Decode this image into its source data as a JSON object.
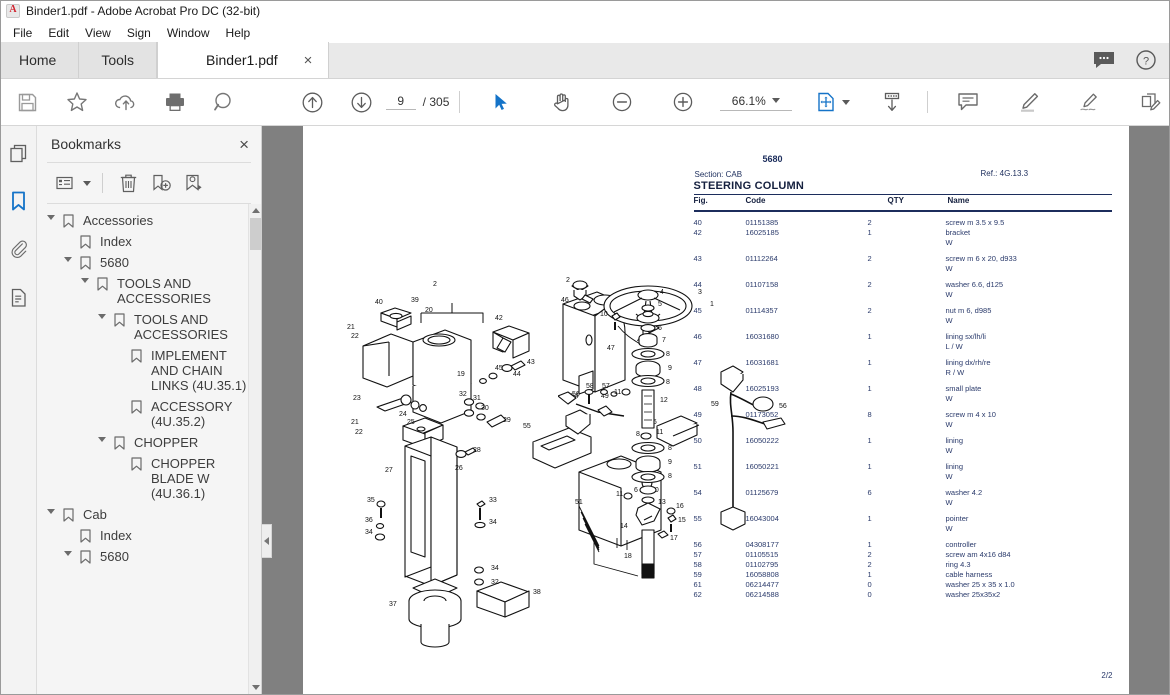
{
  "window": {
    "title": "Binder1.pdf - Adobe Acrobat Pro DC (32-bit)",
    "app_icon": "acrobat-logo-icon"
  },
  "menubar": {
    "items": [
      "File",
      "Edit",
      "View",
      "Sign",
      "Window",
      "Help"
    ]
  },
  "tabs": {
    "home_label": "Home",
    "tools_label": "Tools",
    "doc_label": "Binder1.pdf",
    "close_glyph": "×",
    "right_icons": [
      "comment-bubble-icon",
      "help-question-icon"
    ]
  },
  "toolbar": {
    "icons": [
      "save-icon",
      "star-icon",
      "cloud-upload-icon",
      "print-icon",
      "zoom-search-icon",
      "previous-page-icon",
      "next-page-icon"
    ],
    "page_current": "9",
    "page_total": "/ 305",
    "tool_icons": [
      "select-cursor-icon",
      "hand-pan-icon",
      "zoom-out-icon",
      "zoom-in-icon"
    ],
    "zoom_value": "66.1%",
    "fit_icon": "fit-page-icon",
    "scroll_icon": "scroll-mode-icon",
    "right_icons": [
      "comment-icon",
      "highlight-icon",
      "sign-icon",
      "edit-pdf-icon"
    ]
  },
  "rail": {
    "items": [
      {
        "name": "page-thumbnails-icon",
        "active": false
      },
      {
        "name": "bookmarks-icon",
        "active": true
      },
      {
        "name": "attachments-icon",
        "active": false
      },
      {
        "name": "document-properties-icon",
        "active": false
      }
    ]
  },
  "bookmarks_panel": {
    "title": "Bookmarks",
    "close_glyph": "×",
    "tools": [
      "options-list-icon",
      "delete-bookmark-icon",
      "new-bookmark-icon",
      "edit-bookmark-icon"
    ],
    "tree": [
      {
        "label": "Accessories",
        "indent": 0,
        "expanded": true
      },
      {
        "label": "Index",
        "indent": 1,
        "expanded": null
      },
      {
        "label": "5680",
        "indent": 1,
        "expanded": true
      },
      {
        "label": "TOOLS AND ACCESSORIES",
        "indent": 2,
        "expanded": true
      },
      {
        "label": "TOOLS AND ACCESSORIES",
        "indent": 3,
        "expanded": true
      },
      {
        "label": "IMPLEMENT AND CHAIN LINKS (4U.35.1)",
        "indent": 4,
        "expanded": null
      },
      {
        "label": "ACCESSORY (4U.35.2)",
        "indent": 4,
        "expanded": null
      },
      {
        "label": "CHOPPER",
        "indent": 3,
        "expanded": true
      },
      {
        "label": "CHOPPER BLADE W (4U.36.1)",
        "indent": 4,
        "expanded": null
      },
      {
        "label": "Cab",
        "indent": 0,
        "expanded": true
      },
      {
        "label": "Index",
        "indent": 1,
        "expanded": null
      },
      {
        "label": "5680",
        "indent": 1,
        "expanded": true
      }
    ]
  },
  "document": {
    "model_number": "5680",
    "section_label": "Section: CAB",
    "ref_label": "Ref.: 4G.13.3",
    "sheet_title": "STEERING COLUMN",
    "columns": [
      "Fig.",
      "Code",
      "QTY",
      "Name"
    ],
    "rows": [
      {
        "fig": "40",
        "code": "01151385",
        "qty": "2",
        "name": "screw m 3.5 x 9.5",
        "sub": "",
        "gap": false
      },
      {
        "fig": "42",
        "code": "16025185",
        "qty": "1",
        "name": "bracket",
        "sub": "W",
        "gap": false
      },
      {
        "fig": "43",
        "code": "01112264",
        "qty": "2",
        "name": "screw m 6 x 20, d933",
        "sub": "W",
        "gap": true
      },
      {
        "fig": "44",
        "code": "01107158",
        "qty": "2",
        "name": "washer 6.6, d125",
        "sub": "W",
        "gap": true
      },
      {
        "fig": "45",
        "code": "01114357",
        "qty": "2",
        "name": "nut m 6, d985",
        "sub": "W",
        "gap": true
      },
      {
        "fig": "46",
        "code": "16031680",
        "qty": "1",
        "name": "lining sx/lh/li",
        "sub": "L / W",
        "gap": true
      },
      {
        "fig": "47",
        "code": "16031681",
        "qty": "1",
        "name": "lining dx/rh/re",
        "sub": "R / W",
        "gap": true
      },
      {
        "fig": "48",
        "code": "16025193",
        "qty": "1",
        "name": "small plate",
        "sub": "W",
        "gap": true
      },
      {
        "fig": "49",
        "code": "01173052",
        "qty": "8",
        "name": "screw m 4 x 10",
        "sub": "W",
        "gap": true
      },
      {
        "fig": "50",
        "code": "16050222",
        "qty": "1",
        "name": "lining",
        "sub": "W",
        "gap": true
      },
      {
        "fig": "51",
        "code": "16050221",
        "qty": "1",
        "name": "lining",
        "sub": "W",
        "gap": true
      },
      {
        "fig": "54",
        "code": "01125679",
        "qty": "6",
        "name": "washer 4.2",
        "sub": "W",
        "gap": true
      },
      {
        "fig": "55",
        "code": "16043004",
        "qty": "1",
        "name": "pointer",
        "sub": "W",
        "gap": true
      },
      {
        "fig": "56",
        "code": "04308177",
        "qty": "1",
        "name": "controller",
        "sub": "",
        "gap": true
      },
      {
        "fig": "57",
        "code": "01105515",
        "qty": "2",
        "name": "screw am 4x16 d84",
        "sub": "",
        "gap": false
      },
      {
        "fig": "58",
        "code": "01102795",
        "qty": "2",
        "name": "ring 4.3",
        "sub": "",
        "gap": false
      },
      {
        "fig": "59",
        "code": "16058808",
        "qty": "1",
        "name": "cable harness",
        "sub": "",
        "gap": false
      },
      {
        "fig": "61",
        "code": "06214477",
        "qty": "0",
        "name": "washer 25 x 35 x 1.0",
        "sub": "",
        "gap": false
      },
      {
        "fig": "62",
        "code": "06214588",
        "qty": "0",
        "name": "washer 25x35x2",
        "sub": "",
        "gap": false
      }
    ],
    "footer": "2/2",
    "diagram_callouts": [
      "1",
      "2",
      "3",
      "4",
      "5",
      "6",
      "7",
      "8",
      "9",
      "10",
      "11",
      "12",
      "13",
      "14",
      "15",
      "16",
      "17",
      "18",
      "19",
      "20",
      "21",
      "22",
      "23",
      "24",
      "25",
      "26",
      "27",
      "28",
      "29",
      "30",
      "31",
      "32",
      "33",
      "34",
      "35",
      "36",
      "37",
      "38",
      "39",
      "40",
      "42",
      "43",
      "44",
      "45",
      "46",
      "47",
      "48",
      "49",
      "50",
      "51",
      "54",
      "55",
      "56",
      "57",
      "58",
      "59"
    ]
  },
  "colors": {
    "accent_blue": "#1473c8",
    "pdf_text": "#2a3a6b",
    "viewport_gray": "#808080",
    "panel_gray": "#f5f5f5"
  }
}
